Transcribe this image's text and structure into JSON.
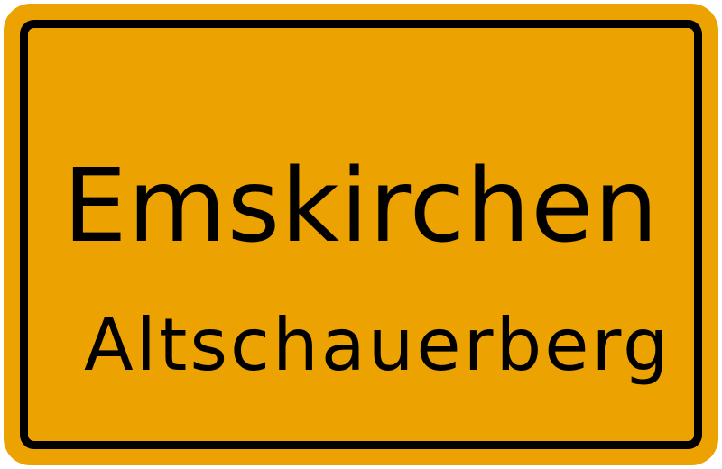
{
  "sign": {
    "background_color": "#eca200",
    "border_color": "#000000",
    "town": "Emskirchen",
    "district": "Altschauerberg"
  }
}
